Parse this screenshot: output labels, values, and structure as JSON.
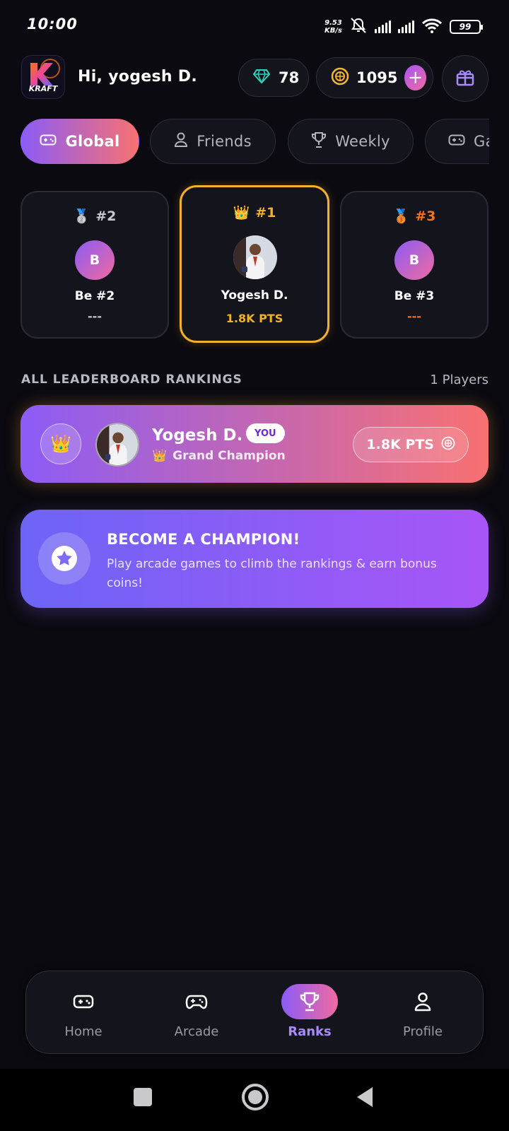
{
  "status_bar": {
    "time": "10:00",
    "net_speed_value": "9.53",
    "net_speed_unit": "KB/s",
    "battery": "99"
  },
  "header": {
    "logo_text": "KRAFT",
    "greeting": "Hi, yogesh D.",
    "gems": "78",
    "coins": "1095",
    "add_label": "+"
  },
  "tabs": [
    {
      "label": "Global",
      "icon": "gamepad-icon",
      "active": true
    },
    {
      "label": "Friends",
      "icon": "user-icon",
      "active": false
    },
    {
      "label": "Weekly",
      "icon": "trophy-icon",
      "active": false
    },
    {
      "label": "Ga",
      "icon": "gamepad-icon",
      "active": false
    }
  ],
  "podium": {
    "second": {
      "medal": "🥈",
      "rank": "#2",
      "initial": "B",
      "name": "Be #2",
      "points": "---"
    },
    "first": {
      "medal": "👑",
      "rank": "#1",
      "name": "Yogesh D.",
      "points": "1.8K PTS"
    },
    "third": {
      "medal": "🥉",
      "rank": "#3",
      "initial": "B",
      "name": "Be #3",
      "points": "---"
    }
  },
  "leaderboard": {
    "title": "ALL LEADERBOARD RANKINGS",
    "count": "1 Players",
    "rows": [
      {
        "badge": "👑",
        "name": "Yogesh D.",
        "you_label": "YOU",
        "title_icon": "👑",
        "title": "Grand Champion",
        "points": "1.8K PTS"
      }
    ]
  },
  "promo": {
    "title": "BECOME A CHAMPION!",
    "text": "Play arcade games to climb the rankings & earn bonus coins!"
  },
  "bottom_nav": [
    {
      "label": "Home",
      "icon": "gamepad-icon",
      "active": false
    },
    {
      "label": "Arcade",
      "icon": "controller-icon",
      "active": false
    },
    {
      "label": "Ranks",
      "icon": "trophy-icon",
      "active": true
    },
    {
      "label": "Profile",
      "icon": "user-icon",
      "active": false
    }
  ],
  "colors": {
    "background": "#0b0a10",
    "accent_gradient_start": "#8b5cf6",
    "accent_gradient_end": "#f87171",
    "gold": "#f2b12a",
    "bronze": "#f97316",
    "gem": "#2dd4bf"
  }
}
